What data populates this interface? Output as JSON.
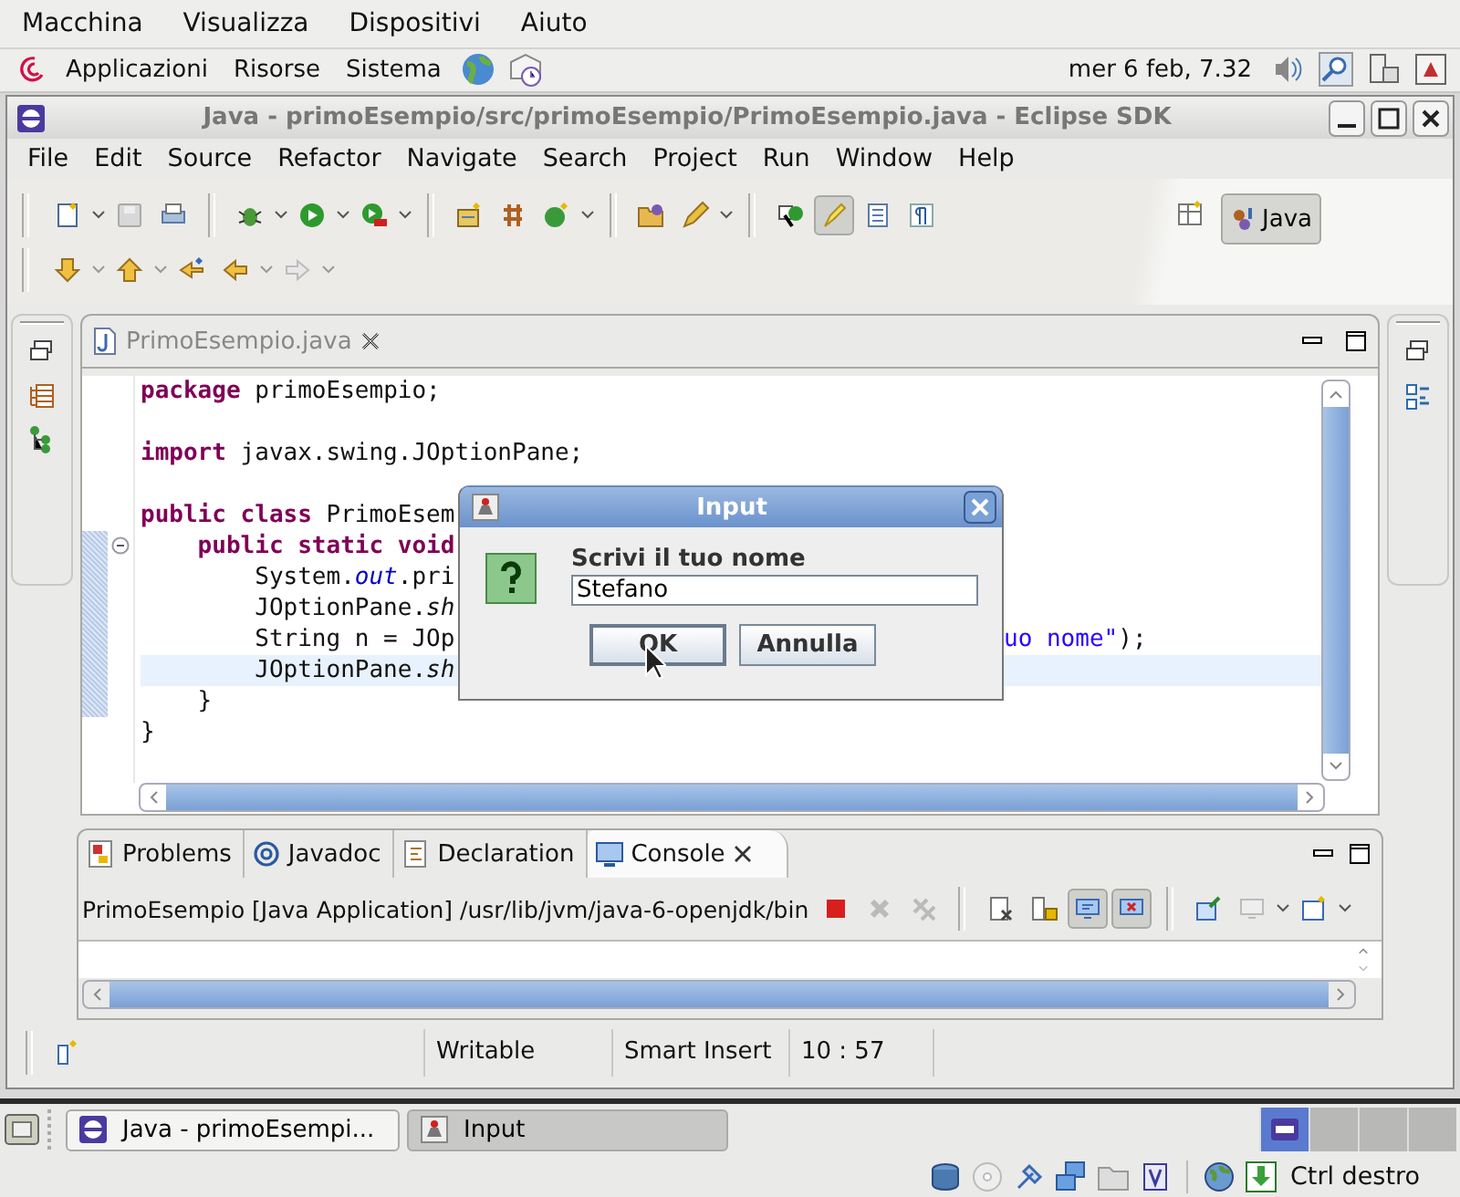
{
  "vm_menu": [
    "Macchina",
    "Visualizza",
    "Dispositivi",
    "Aiuto"
  ],
  "panel": {
    "menus": [
      "Applicazioni",
      "Risorse",
      "Sistema"
    ],
    "clock": "mer  6 feb, 7.32"
  },
  "window": {
    "title": "Java - primoEsempio/src/primoEsempio/PrimoEsempio.java - Eclipse SDK"
  },
  "menu": [
    "File",
    "Edit",
    "Source",
    "Refactor",
    "Navigate",
    "Search",
    "Project",
    "Run",
    "Window",
    "Help"
  ],
  "perspective": {
    "label": "Java",
    "selected": true
  },
  "editor": {
    "tab": "PrimoEsempio.java",
    "lines": [
      {
        "tokens": [
          {
            "kind": "keyword",
            "text": "package"
          },
          {
            "kind": "plain",
            "text": " primoEsempio;"
          }
        ],
        "fold": false,
        "range": false,
        "current": false
      },
      {
        "fold": false,
        "range": false,
        "current": false
      },
      {
        "tokens": [
          {
            "kind": "keyword",
            "text": "import"
          },
          {
            "kind": "plain",
            "text": " javax.swing.JOptionPane;"
          }
        ],
        "fold": false,
        "range": false,
        "current": false
      },
      {
        "fold": false,
        "range": false,
        "current": false
      },
      {
        "tokens": [
          {
            "kind": "keyword",
            "text": "public class"
          },
          {
            "kind": "plain",
            "text": " PrimoEsem"
          }
        ],
        "fold": false,
        "range": false,
        "current": false
      },
      {
        "tokens": [
          {
            "kind": "keyword",
            "text": "    public static void"
          }
        ],
        "fold": true,
        "range": true,
        "current": false
      },
      {
        "tokens": [
          {
            "kind": "plain",
            "text": "        System."
          },
          {
            "kind": "field",
            "text": "out"
          },
          {
            "kind": "plain",
            "text": ".pri"
          }
        ],
        "fold": false,
        "range": true,
        "current": false
      },
      {
        "tokens": [
          {
            "kind": "plain",
            "text": "        JOptionPane."
          },
          {
            "kind": "static",
            "text": "sh"
          }
        ],
        "fold": false,
        "range": true,
        "current": false
      },
      {
        "tokens": [
          {
            "kind": "plain",
            "text": "        String n = JOp"
          }
        ],
        "right": [
          {
            "kind": "string",
            "text": "uo nome\""
          },
          {
            "kind": "plain",
            "text": ");"
          }
        ],
        "fold": false,
        "range": true,
        "current": false
      },
      {
        "tokens": [
          {
            "kind": "plain",
            "text": "        JOptionPane."
          },
          {
            "kind": "static",
            "text": "sh"
          }
        ],
        "fold": false,
        "range": true,
        "current": true
      },
      {
        "tokens": [
          {
            "kind": "plain",
            "text": "    }"
          }
        ],
        "fold": false,
        "range": true,
        "current": false
      },
      {
        "tokens": [
          {
            "kind": "plain",
            "text": "}"
          }
        ],
        "fold": false,
        "range": false,
        "current": false
      }
    ]
  },
  "dialog": {
    "title": "Input",
    "message": "Scrivi il tuo nome",
    "value": "Stefano",
    "buttons": [
      {
        "label": "OK",
        "selected": true
      },
      {
        "label": "Annulla",
        "selected": false
      }
    ]
  },
  "console": {
    "tabs": [
      {
        "label": "Problems",
        "selected": false
      },
      {
        "label": "Javadoc",
        "selected": false
      },
      {
        "label": "Declaration",
        "selected": false
      },
      {
        "label": "Console",
        "selected": true
      }
    ],
    "process": "PrimoEsempio [Java Application] /usr/lib/jvm/java-6-openjdk/bin"
  },
  "status": [
    "Writable",
    "Smart Insert",
    "10 : 57"
  ],
  "taskbar": [
    {
      "label": "Java - primoEsempi...",
      "selected": false
    },
    {
      "label": "Input",
      "selected": true
    }
  ],
  "vbox_status": {
    "host_key": "Ctrl destro"
  }
}
